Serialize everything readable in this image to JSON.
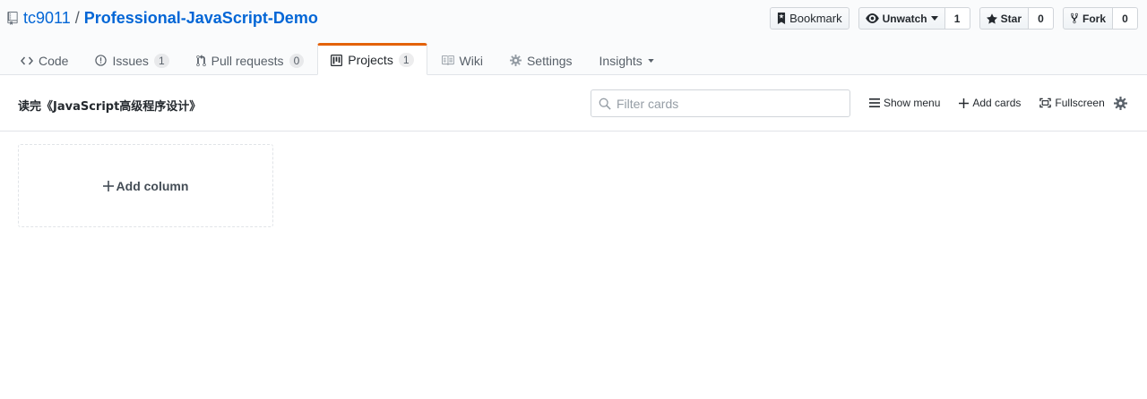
{
  "repo": {
    "owner": "tc9011",
    "separator": "/",
    "name": "Professional-JavaScript-Demo"
  },
  "actions": {
    "bookmark_label": "Bookmark",
    "unwatch_label": "Unwatch",
    "watch_count": "1",
    "star_label": "Star",
    "star_count": "0",
    "fork_label": "Fork",
    "fork_count": "0"
  },
  "tabs": [
    {
      "label": "Code",
      "icon": "code-icon"
    },
    {
      "label": "Issues",
      "counter": "1",
      "icon": "issue-icon"
    },
    {
      "label": "Pull requests",
      "counter": "0",
      "icon": "pull-request-icon"
    },
    {
      "label": "Projects",
      "counter": "1",
      "icon": "project-icon",
      "selected": true
    },
    {
      "label": "Wiki",
      "icon": "book-icon"
    },
    {
      "label": "Settings",
      "icon": "gear-icon"
    },
    {
      "label": "Insights",
      "icon": "caret-down-icon"
    }
  ],
  "project": {
    "title": "读完《JavaScript高级程序设计》",
    "filter_placeholder": "Filter cards",
    "show_menu_label": "Show menu",
    "add_cards_label": "Add cards",
    "fullscreen_label": "Fullscreen"
  },
  "board": {
    "add_column_label": "Add column"
  },
  "colors": {
    "link": "#0366d6",
    "selected_tab_accent": "#e36209",
    "border": "#e1e4e8",
    "header_bg": "#fafbfc"
  }
}
